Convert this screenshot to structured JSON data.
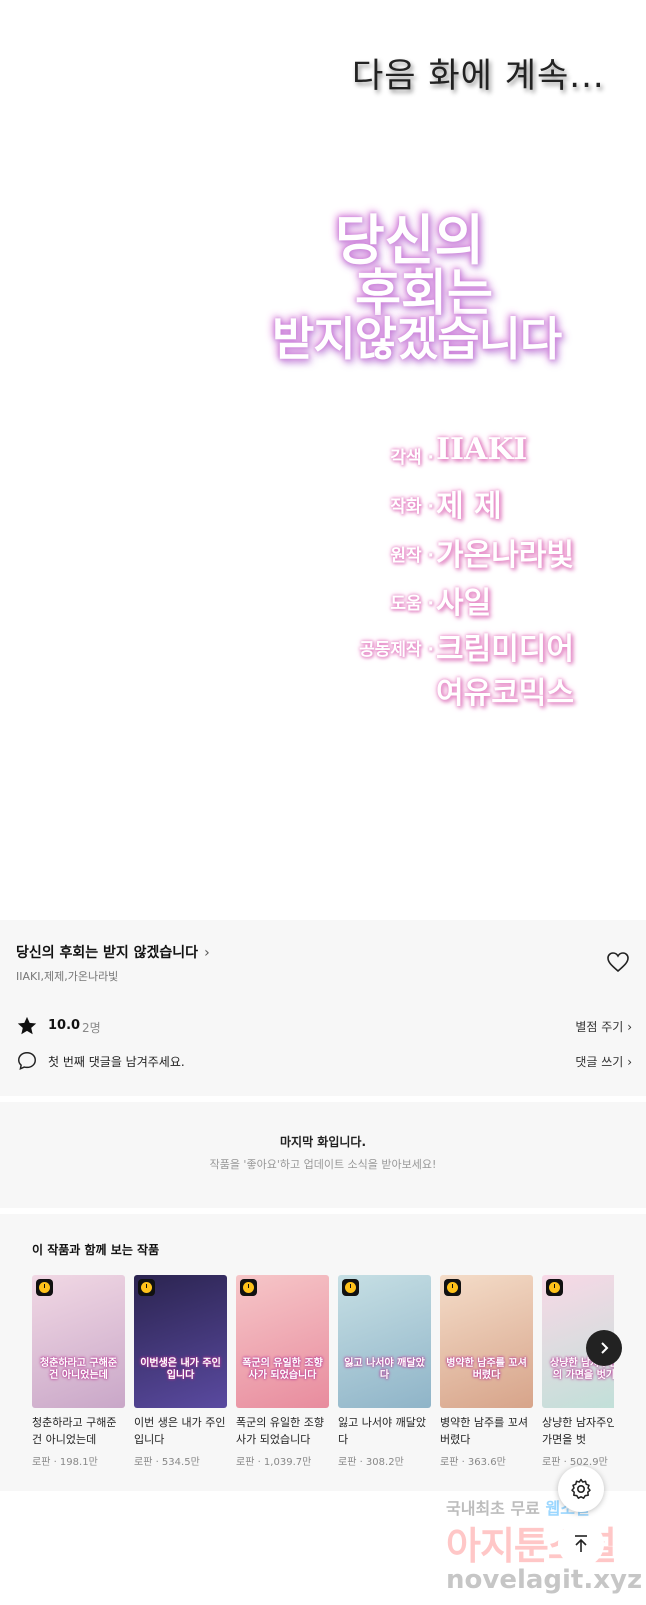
{
  "comic": {
    "to_be_continued": "다음 화에 계속...",
    "logo_lines": [
      "당신의",
      "후회는",
      "받지않겠습니다"
    ],
    "credits": [
      {
        "role": "각색 ·",
        "name": "IIAKI"
      },
      {
        "role": "작화 ·",
        "name": "제 제"
      },
      {
        "role": "원작 ·",
        "name": "가온나라빛"
      },
      {
        "role": "도움 ·",
        "name": "사일"
      },
      {
        "role": "공동제작 ·",
        "name": "크림미디어"
      },
      {
        "role": "",
        "name": "여유코믹스"
      }
    ]
  },
  "info": {
    "series_title": "당신의 후회는 받지 않겠습니다",
    "authors": "IIAKI,제제,가온나라빛",
    "rating": "10.0",
    "raters": "2명",
    "rate_link": "별점 주기",
    "comment_prompt": "첫 번째 댓글을 남겨주세요.",
    "comment_link": "댓글 쓰기"
  },
  "last_episode": {
    "title": "마지막 화입니다.",
    "subtitle": "작품을 '좋아요'하고 업데이트 소식을 받아보세요!"
  },
  "recommendations": {
    "title": "이 작품과 함께 보는 작품",
    "items": [
      {
        "title": "청춘하라고 구해준 건 아니었는데",
        "meta": "로판 · 198.1만",
        "cover_text": "청춘하라고 구해준 건 아니었는데",
        "color_a": "#f1d8e4",
        "color_b": "#c9a7c8"
      },
      {
        "title": "이번 생은 내가 주인입니다",
        "meta": "로판 · 534.5만",
        "cover_text": "이번생은 내가 주인입니다",
        "color_a": "#2b2450",
        "color_b": "#5a4aa0"
      },
      {
        "title": "폭군의 유일한 조향사가 되었습니다",
        "meta": "로판 · 1,039.7만",
        "cover_text": "폭군의 유일한 조향사가 되었습니다",
        "color_a": "#f6c6c8",
        "color_b": "#e88c9e"
      },
      {
        "title": "잃고 나서야 깨달았다",
        "meta": "로판 · 308.2만",
        "cover_text": "잃고 나서야 깨달았다",
        "color_a": "#c6dfe4",
        "color_b": "#8fb4c8"
      },
      {
        "title": "병약한 남주를 꼬셔버렸다",
        "meta": "로판 · 363.6만",
        "cover_text": "병약한 남주를 꼬셔버렸다",
        "color_a": "#f4dcc8",
        "color_b": "#d7a48a"
      },
      {
        "title": "상냥한 남자주인공의 가면을 벗",
        "meta": "로판 · 502.9만",
        "cover_text": "상냥한 남자주인공의 가면을 벗기면",
        "color_a": "#f8d8e6",
        "color_b": "#bfe0d8"
      }
    ]
  },
  "watermark": {
    "line1_a": "국내최초 무료",
    "line1_b": "웹소설",
    "line2": "아지툰소설",
    "line3": "novelagit.xyz"
  },
  "colors": {
    "panel_bg": "#f7f7f7",
    "logo_glow": "#e49ce6",
    "badge_yellow": "#ffc21a"
  },
  "icons": {
    "heart": "heart-icon",
    "star": "star-icon",
    "comment": "comment-icon",
    "next": "chevron-right-icon",
    "settings": "gear-icon",
    "top": "arrow-up-icon"
  }
}
